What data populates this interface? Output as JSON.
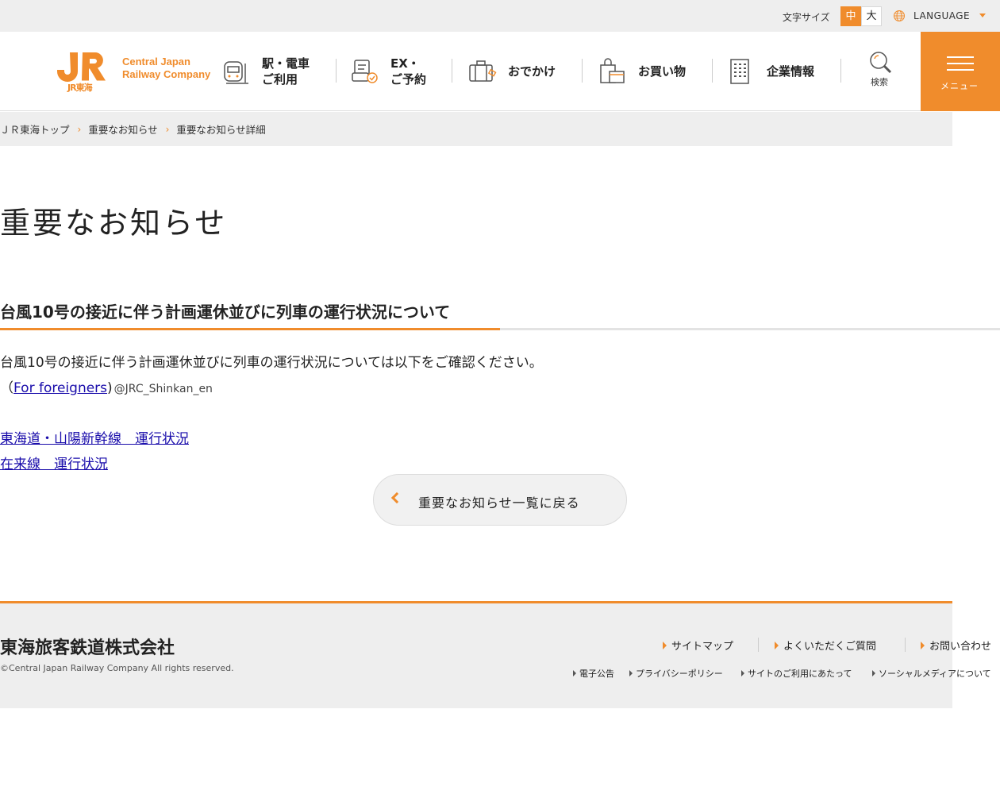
{
  "colors": {
    "accent": "#f08c2c",
    "link": "#1a0dab",
    "bar_bg": "#eeeeee"
  },
  "topbar": {
    "font_size_label": "文字サイズ",
    "font_size_medium": "中",
    "font_size_large": "大",
    "language_label": "LANGUAGE",
    "language_icon": "globe-icon"
  },
  "header": {
    "logo_text": "JR東海",
    "logo_en_line1": "Central Japan",
    "logo_en_line2": "Railway Company",
    "nav": [
      {
        "label": "駅・電車\nご利用",
        "icon": "train-icon"
      },
      {
        "label": "EX・\nご予約",
        "icon": "reservation-icon"
      },
      {
        "label": "おでかけ",
        "icon": "suitcase-icon"
      },
      {
        "label": "お買い物",
        "icon": "shopping-bag-icon"
      },
      {
        "label": "企業情報",
        "icon": "building-icon"
      }
    ],
    "search_label": "検索",
    "menu_label": "メニュー"
  },
  "breadcrumb": [
    "ＪＲ東海トップ",
    "重要なお知らせ",
    "重要なお知らせ詳細"
  ],
  "main": {
    "page_title": "重要なお知らせ",
    "article_title": "台風10号の接近に伴う計画運休並びに列車の運行状況について",
    "body_text": "台風10号の接近に伴う計画運休並びに列車の運行状況については以下をご確認ください。",
    "for_foreigners_open": "（",
    "for_foreigners_link": "For foreigners",
    "for_foreigners_close": ")",
    "twitter_handle": "@JRC_Shinkan_en",
    "link_shinkansen": "東海道・山陽新幹線　運行状況",
    "link_conventional": "在来線　運行状況",
    "back_button": "重要なお知らせ一覧に戻る"
  },
  "footer": {
    "company_name": "東海旅客鉄道株式会社",
    "copyright": "©Central Japan Railway Company All rights reserved.",
    "links_primary": [
      "サイトマップ",
      "よくいただくご質問",
      "お問い合わせ"
    ],
    "links_secondary": [
      "電子公告",
      "プライバシーポリシー",
      "サイトのご利用にあたって",
      "ソーシャルメディアについて"
    ]
  }
}
